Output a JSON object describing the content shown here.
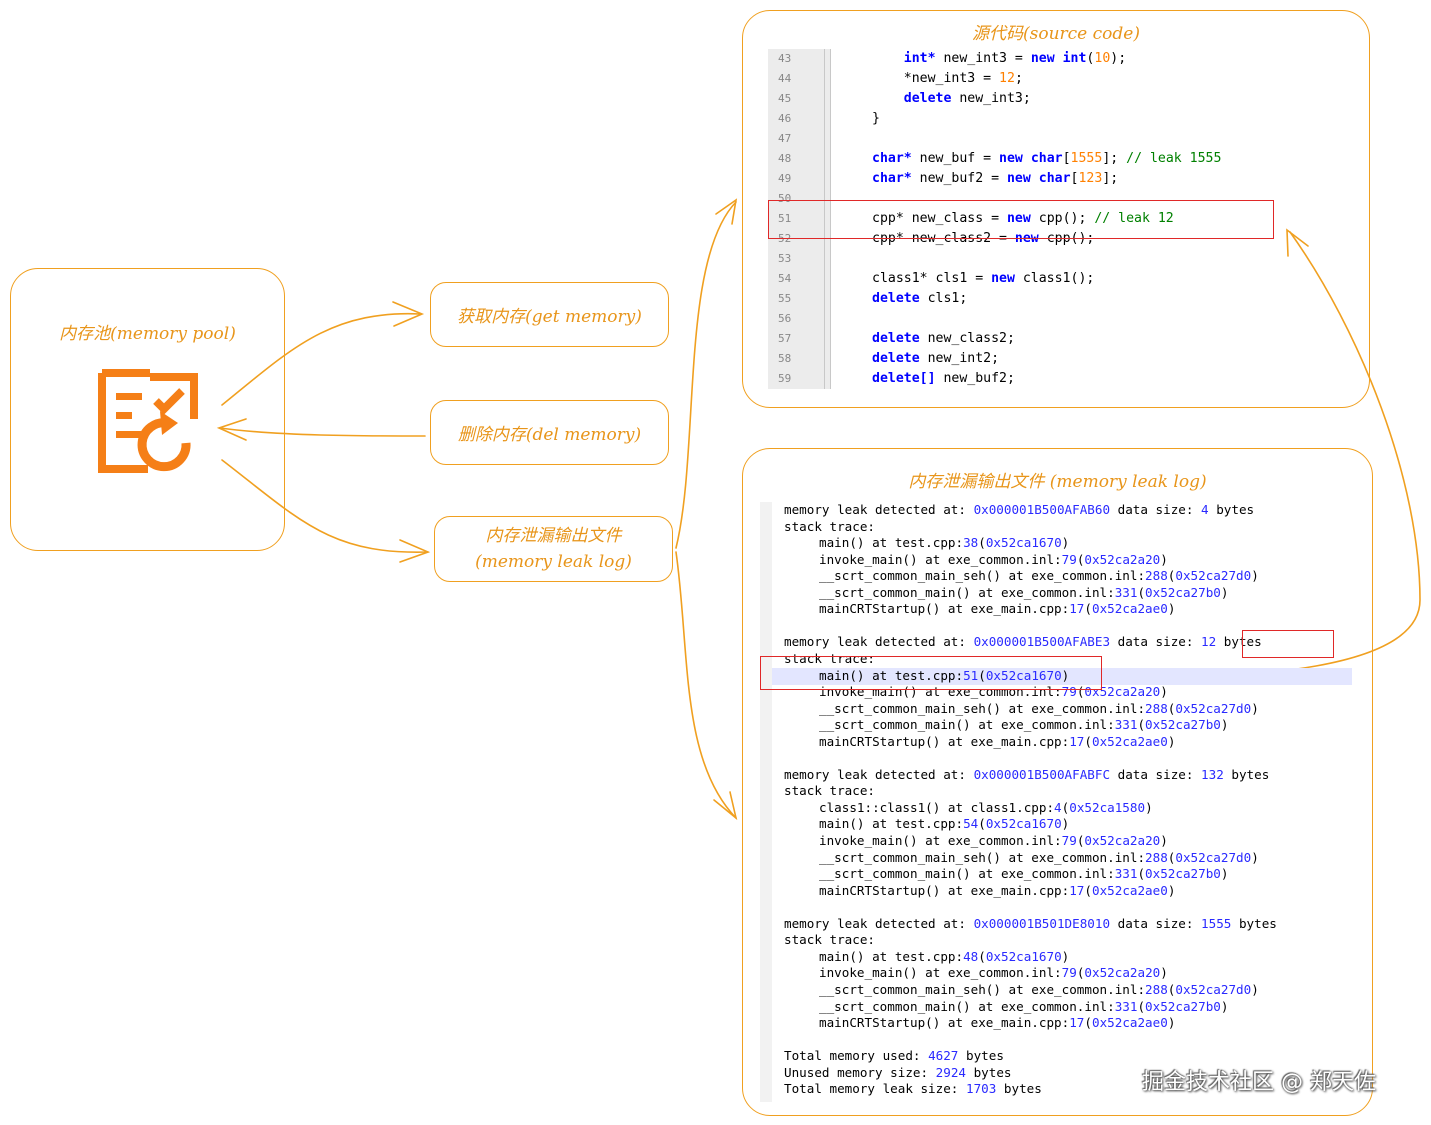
{
  "pool": {
    "title": "内存池(memory pool)",
    "icon": "checklist-refresh-icon"
  },
  "actions": {
    "get": "获取内存(get memory)",
    "del": "删除内存(del memory)",
    "leak_line1": "内存泄漏输出文件",
    "leak_line2": "(memory leak log)"
  },
  "source": {
    "title": "源代码(source code)",
    "lines": [
      {
        "n": "43",
        "code": [
          [
            "    ",
            ""
          ],
          [
            "int*",
            "kw"
          ],
          [
            " new_int3 = ",
            ""
          ],
          [
            "new",
            "kw"
          ],
          [
            " ",
            ""
          ],
          [
            "int",
            "kw"
          ],
          [
            "(",
            ""
          ],
          [
            "10",
            "num"
          ],
          [
            ");",
            ""
          ]
        ]
      },
      {
        "n": "44",
        "code": [
          [
            "    *new_int3 = ",
            ""
          ],
          [
            "12",
            "num"
          ],
          [
            ";",
            ""
          ]
        ]
      },
      {
        "n": "45",
        "code": [
          [
            "    ",
            ""
          ],
          [
            "delete",
            "kw"
          ],
          [
            " new_int3;",
            ""
          ]
        ]
      },
      {
        "n": "46",
        "code": [
          [
            "}",
            ""
          ]
        ]
      },
      {
        "n": "47",
        "code": []
      },
      {
        "n": "48",
        "code": [
          [
            "char*",
            "kw"
          ],
          [
            " new_buf = ",
            ""
          ],
          [
            "new",
            "kw"
          ],
          [
            " ",
            ""
          ],
          [
            "char",
            "kw"
          ],
          [
            "[",
            ""
          ],
          [
            "1555",
            "num"
          ],
          [
            "]; ",
            ""
          ],
          [
            "// leak 1555",
            "cmt"
          ]
        ]
      },
      {
        "n": "49",
        "code": [
          [
            "char*",
            "kw"
          ],
          [
            " new_buf2 = ",
            ""
          ],
          [
            "new",
            "kw"
          ],
          [
            " ",
            ""
          ],
          [
            "char",
            "kw"
          ],
          [
            "[",
            ""
          ],
          [
            "123",
            "num"
          ],
          [
            "];",
            ""
          ]
        ]
      },
      {
        "n": "50",
        "code": []
      },
      {
        "n": "51",
        "code": [
          [
            "cpp* new_class = ",
            ""
          ],
          [
            "new",
            "kw"
          ],
          [
            " cpp(); ",
            ""
          ],
          [
            "// leak 12",
            "cmt"
          ]
        ]
      },
      {
        "n": "52",
        "code": [
          [
            "cpp* new_class2 = ",
            ""
          ],
          [
            "new",
            "kw"
          ],
          [
            " cpp();",
            ""
          ]
        ]
      },
      {
        "n": "53",
        "code": []
      },
      {
        "n": "54",
        "code": [
          [
            "class1* cls1 = ",
            ""
          ],
          [
            "new",
            "kw"
          ],
          [
            " class1();",
            ""
          ]
        ]
      },
      {
        "n": "55",
        "code": [
          [
            "delete",
            "kw"
          ],
          [
            " cls1;",
            ""
          ]
        ]
      },
      {
        "n": "56",
        "code": []
      },
      {
        "n": "57",
        "code": [
          [
            "delete",
            "kw"
          ],
          [
            " new_class2;",
            ""
          ]
        ]
      },
      {
        "n": "58",
        "code": [
          [
            "delete",
            "kw"
          ],
          [
            " new_int2;",
            ""
          ]
        ]
      },
      {
        "n": "59",
        "code": [
          [
            "delete[]",
            "kw"
          ],
          [
            " new_buf2;",
            ""
          ]
        ]
      }
    ]
  },
  "log": {
    "title": "内存泄漏输出文件 (memory leak log)",
    "lines": [
      {
        "i": 0,
        "t": [
          [
            "memory leak detected at: ",
            ""
          ],
          [
            "0x000001B500AFAB60",
            "blue"
          ],
          [
            " data size: ",
            ""
          ],
          [
            "4",
            "blue"
          ],
          [
            " bytes",
            ""
          ]
        ]
      },
      {
        "i": 0,
        "t": [
          [
            "stack trace:",
            ""
          ]
        ]
      },
      {
        "i": 1,
        "t": [
          [
            "main() at test.cpp:",
            ""
          ],
          [
            "38",
            "blue"
          ],
          [
            "(",
            ""
          ],
          [
            "0x52ca1670",
            "blue"
          ],
          [
            ")",
            ""
          ]
        ]
      },
      {
        "i": 1,
        "t": [
          [
            "invoke_main() at exe_common.inl:",
            ""
          ],
          [
            "79",
            "blue"
          ],
          [
            "(",
            ""
          ],
          [
            "0x52ca2a20",
            "blue"
          ],
          [
            ")",
            ""
          ]
        ]
      },
      {
        "i": 1,
        "t": [
          [
            "__scrt_common_main_seh() at exe_common.inl:",
            ""
          ],
          [
            "288",
            "blue"
          ],
          [
            "(",
            ""
          ],
          [
            "0x52ca27d0",
            "blue"
          ],
          [
            ")",
            ""
          ]
        ]
      },
      {
        "i": 1,
        "t": [
          [
            "__scrt_common_main() at exe_common.inl:",
            ""
          ],
          [
            "331",
            "blue"
          ],
          [
            "(",
            ""
          ],
          [
            "0x52ca27b0",
            "blue"
          ],
          [
            ")",
            ""
          ]
        ]
      },
      {
        "i": 1,
        "t": [
          [
            "mainCRTStartup() at exe_main.cpp:",
            ""
          ],
          [
            "17",
            "blue"
          ],
          [
            "(",
            ""
          ],
          [
            "0x52ca2ae0",
            "blue"
          ],
          [
            ")",
            ""
          ]
        ]
      },
      {
        "i": 0,
        "t": []
      },
      {
        "i": 0,
        "t": [
          [
            "memory leak detected at: ",
            ""
          ],
          [
            "0x000001B500AFABE3",
            "blue"
          ],
          [
            " data size: ",
            ""
          ],
          [
            "12",
            "blue"
          ],
          [
            " bytes",
            ""
          ]
        ]
      },
      {
        "i": 0,
        "t": [
          [
            "stack trace:",
            ""
          ]
        ]
      },
      {
        "i": 1,
        "hl": true,
        "t": [
          [
            "main() at test.cpp:",
            ""
          ],
          [
            "51",
            "blue"
          ],
          [
            "(",
            ""
          ],
          [
            "0x52ca1670",
            "blue"
          ],
          [
            ")",
            ""
          ]
        ]
      },
      {
        "i": 1,
        "t": [
          [
            "invoke_main() at exe_common.inl:",
            ""
          ],
          [
            "79",
            "blue"
          ],
          [
            "(",
            ""
          ],
          [
            "0x52ca2a20",
            "blue"
          ],
          [
            ")",
            ""
          ]
        ]
      },
      {
        "i": 1,
        "t": [
          [
            "__scrt_common_main_seh() at exe_common.inl:",
            ""
          ],
          [
            "288",
            "blue"
          ],
          [
            "(",
            ""
          ],
          [
            "0x52ca27d0",
            "blue"
          ],
          [
            ")",
            ""
          ]
        ]
      },
      {
        "i": 1,
        "t": [
          [
            "__scrt_common_main() at exe_common.inl:",
            ""
          ],
          [
            "331",
            "blue"
          ],
          [
            "(",
            ""
          ],
          [
            "0x52ca27b0",
            "blue"
          ],
          [
            ")",
            ""
          ]
        ]
      },
      {
        "i": 1,
        "t": [
          [
            "mainCRTStartup() at exe_main.cpp:",
            ""
          ],
          [
            "17",
            "blue"
          ],
          [
            "(",
            ""
          ],
          [
            "0x52ca2ae0",
            "blue"
          ],
          [
            ")",
            ""
          ]
        ]
      },
      {
        "i": 0,
        "t": []
      },
      {
        "i": 0,
        "t": [
          [
            "memory leak detected at: ",
            ""
          ],
          [
            "0x000001B500AFABFC",
            "blue"
          ],
          [
            " data size: ",
            ""
          ],
          [
            "132",
            "blue"
          ],
          [
            " bytes",
            ""
          ]
        ]
      },
      {
        "i": 0,
        "t": [
          [
            "stack trace:",
            ""
          ]
        ]
      },
      {
        "i": 1,
        "t": [
          [
            "class1::class1() at class1.cpp:",
            ""
          ],
          [
            "4",
            "blue"
          ],
          [
            "(",
            ""
          ],
          [
            "0x52ca1580",
            "blue"
          ],
          [
            ")",
            ""
          ]
        ]
      },
      {
        "i": 1,
        "t": [
          [
            "main() at test.cpp:",
            ""
          ],
          [
            "54",
            "blue"
          ],
          [
            "(",
            ""
          ],
          [
            "0x52ca1670",
            "blue"
          ],
          [
            ")",
            ""
          ]
        ]
      },
      {
        "i": 1,
        "t": [
          [
            "invoke_main() at exe_common.inl:",
            ""
          ],
          [
            "79",
            "blue"
          ],
          [
            "(",
            ""
          ],
          [
            "0x52ca2a20",
            "blue"
          ],
          [
            ")",
            ""
          ]
        ]
      },
      {
        "i": 1,
        "t": [
          [
            "__scrt_common_main_seh() at exe_common.inl:",
            ""
          ],
          [
            "288",
            "blue"
          ],
          [
            "(",
            ""
          ],
          [
            "0x52ca27d0",
            "blue"
          ],
          [
            ")",
            ""
          ]
        ]
      },
      {
        "i": 1,
        "t": [
          [
            "__scrt_common_main() at exe_common.inl:",
            ""
          ],
          [
            "331",
            "blue"
          ],
          [
            "(",
            ""
          ],
          [
            "0x52ca27b0",
            "blue"
          ],
          [
            ")",
            ""
          ]
        ]
      },
      {
        "i": 1,
        "t": [
          [
            "mainCRTStartup() at exe_main.cpp:",
            ""
          ],
          [
            "17",
            "blue"
          ],
          [
            "(",
            ""
          ],
          [
            "0x52ca2ae0",
            "blue"
          ],
          [
            ")",
            ""
          ]
        ]
      },
      {
        "i": 0,
        "t": []
      },
      {
        "i": 0,
        "t": [
          [
            "memory leak detected at: ",
            ""
          ],
          [
            "0x000001B501DE8010",
            "blue"
          ],
          [
            " data size: ",
            ""
          ],
          [
            "1555",
            "blue"
          ],
          [
            " bytes",
            ""
          ]
        ]
      },
      {
        "i": 0,
        "t": [
          [
            "stack trace:",
            ""
          ]
        ]
      },
      {
        "i": 1,
        "t": [
          [
            "main() at test.cpp:",
            ""
          ],
          [
            "48",
            "blue"
          ],
          [
            "(",
            ""
          ],
          [
            "0x52ca1670",
            "blue"
          ],
          [
            ")",
            ""
          ]
        ]
      },
      {
        "i": 1,
        "t": [
          [
            "invoke_main() at exe_common.inl:",
            ""
          ],
          [
            "79",
            "blue"
          ],
          [
            "(",
            ""
          ],
          [
            "0x52ca2a20",
            "blue"
          ],
          [
            ")",
            ""
          ]
        ]
      },
      {
        "i": 1,
        "t": [
          [
            "__scrt_common_main_seh() at exe_common.inl:",
            ""
          ],
          [
            "288",
            "blue"
          ],
          [
            "(",
            ""
          ],
          [
            "0x52ca27d0",
            "blue"
          ],
          [
            ")",
            ""
          ]
        ]
      },
      {
        "i": 1,
        "t": [
          [
            "__scrt_common_main() at exe_common.inl:",
            ""
          ],
          [
            "331",
            "blue"
          ],
          [
            "(",
            ""
          ],
          [
            "0x52ca27b0",
            "blue"
          ],
          [
            ")",
            ""
          ]
        ]
      },
      {
        "i": 1,
        "t": [
          [
            "mainCRTStartup() at exe_main.cpp:",
            ""
          ],
          [
            "17",
            "blue"
          ],
          [
            "(",
            ""
          ],
          [
            "0x52ca2ae0",
            "blue"
          ],
          [
            ")",
            ""
          ]
        ]
      },
      {
        "i": 0,
        "t": []
      },
      {
        "i": 0,
        "t": [
          [
            "Total memory used: ",
            ""
          ],
          [
            "4627",
            "blue"
          ],
          [
            " bytes",
            ""
          ]
        ]
      },
      {
        "i": 0,
        "t": [
          [
            "Unused memory size: ",
            ""
          ],
          [
            "2924",
            "blue"
          ],
          [
            " bytes",
            ""
          ]
        ]
      },
      {
        "i": 0,
        "t": [
          [
            "Total memory leak size: ",
            ""
          ],
          [
            "1703",
            "blue"
          ],
          [
            " bytes",
            ""
          ]
        ]
      }
    ]
  },
  "watermark": "掘金技术社区 @ 郑天佐",
  "colors": {
    "accent": "#f0a020",
    "highlight": "#e02828",
    "keyword": "#0000ff",
    "number": "#ff8000",
    "comment": "#008000"
  }
}
